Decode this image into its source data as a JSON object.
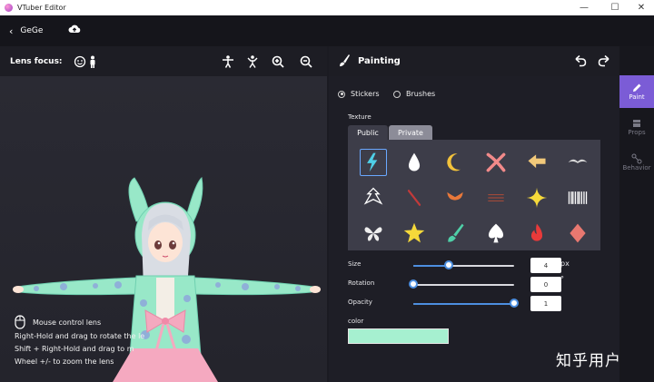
{
  "window": {
    "title": "VTuber Editor",
    "minimize": "—",
    "maximize": "☐",
    "close": "✕"
  },
  "topbar": {
    "back_label": "GeGe",
    "upload_icon": "cloud-upload-icon"
  },
  "lens": {
    "label": "Lens focus:"
  },
  "hints": {
    "mouse_control": "Mouse control lens",
    "rotate": "Right-Hold and drag to rotate the le",
    "move": "Shift + Right-Hold and drag to m",
    "zoom": "Wheel +/- to zoom the lens"
  },
  "painting": {
    "title": "Painting",
    "mode_stickers": "Stickers",
    "mode_brushes": "Brushes",
    "selected_mode": "Stickers",
    "texture_label": "Texture",
    "tabs": [
      "Public",
      "Private"
    ],
    "active_tab": "Public",
    "stickers": [
      {
        "name": "lightning",
        "color": "#4fd0e8"
      },
      {
        "name": "drop",
        "color": "#ffffff"
      },
      {
        "name": "crescent-moon",
        "color": "#f2c23b"
      },
      {
        "name": "feather-cross",
        "color": "#f28a8a"
      },
      {
        "name": "arrow-left",
        "color": "#f2c97a"
      },
      {
        "name": "mustache-ornament",
        "color": "#d8d8d8"
      },
      {
        "name": "tribal-mask",
        "color": "#ffffff"
      },
      {
        "name": "red-streak",
        "color": "#c23a3a"
      },
      {
        "name": "orange-wings",
        "color": "#e8783a"
      },
      {
        "name": "brown-lines",
        "color": "#a04a3a"
      },
      {
        "name": "sparkle-star",
        "color": "#f5d93a"
      },
      {
        "name": "barcode",
        "color": "#ffffff"
      },
      {
        "name": "butterfly",
        "color": "#eeeeee"
      },
      {
        "name": "star",
        "color": "#f5d93a"
      },
      {
        "name": "paint-brush",
        "color": "#4fd0a8"
      },
      {
        "name": "spade",
        "color": "#ffffff"
      },
      {
        "name": "flame",
        "color": "#e83a3a"
      },
      {
        "name": "diamond",
        "color": "#e87870"
      }
    ],
    "size_label": "Size",
    "size_value": "4",
    "size_unit": "px",
    "size_fraction": 0.35,
    "rotation_label": "Rotation",
    "rotation_value": "0",
    "rotation_unit": "°",
    "rotation_fraction": 0.0,
    "opacity_label": "Opacity",
    "opacity_value": "1",
    "opacity_fraction": 1.0,
    "color_label": "color",
    "color_value": "#a6f0d0"
  },
  "rail": {
    "paint": "Paint",
    "props": "Props",
    "behavior": "Behavior"
  },
  "watermark": "知乎用户"
}
